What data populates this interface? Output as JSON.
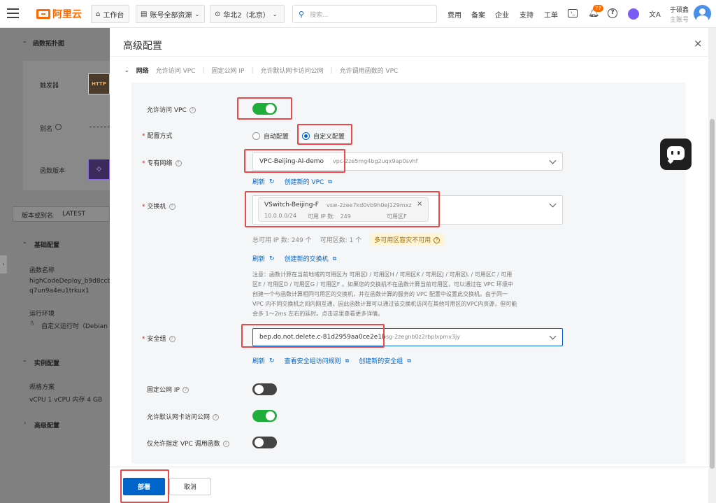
{
  "topbar": {
    "logo": "阿里云",
    "workbench": "工作台",
    "account_scope": "账号全部资源",
    "region": "华北2（北京）",
    "search_placeholder": "搜索...",
    "links": [
      "费用",
      "备案",
      "企业",
      "支持",
      "工单"
    ],
    "notification_count": "77",
    "user_name": "于硕鑫",
    "user_role": "主账号"
  },
  "background": {
    "topology_title": "函数拓扑图",
    "trigger_label": "触发器",
    "trigger_badge": "HTTP",
    "alias_label": "别名",
    "version_label": "函数版本",
    "version_alias": "版本或别名",
    "version_alias_value": "LATEST",
    "basic_title": "基础配置",
    "func_name_label": "函数名称",
    "func_name_line1": "highCodeDeploy_b9d8ccb2",
    "func_name_line2": "q7un9a4eu1trkux1",
    "runtime_label": "运行环境",
    "runtime_value": "自定义运行时（Debian",
    "instance_title": "实例配置",
    "spec_label": "规格方案",
    "spec_value": "vCPU  1 vCPU    内存  4 GB",
    "advanced_title": "高级配置"
  },
  "drawer": {
    "title": "高级配置",
    "close": "×",
    "tabs": [
      "网络",
      "允许访问 VPC",
      "固定公网 IP",
      "允许默认网卡访问公网",
      "允许调用函数的 VPC"
    ],
    "allow_vpc_label": "允许访问 VPC",
    "config_mode_label": "配置方式",
    "auto_config": "自动配置",
    "custom_config": "自定义配置",
    "vpc_label": "专有网络",
    "vpc_name": "VPC-Beijing-AI-demo",
    "vpc_id": "vpc-2ze5mg4bg2uqx9ap0svhf",
    "refresh": "刷新",
    "create_vpc": "创建新的 VPC",
    "vswitch_label": "交换机",
    "vswitch_name": "VSwitch-Beijing-F",
    "vswitch_id": "vsw-2zee7kd0vb9h0ej129mxz",
    "vswitch_cidr": "10.0.0.0/24",
    "vswitch_ips": "可用 IP 数:   249",
    "vswitch_zone": "可用区F",
    "total_ips": "总可用 IP 数: 249 个",
    "zone_count": "可用区数: 1 个",
    "multi_zone": "多可用区容灾不可用",
    "create_vswitch": "创建新的交换机",
    "note_lines": [
      "注意：函数计算在当前地域的可用区为 可用区I / 可用区H / 可用区K / 可用区J / 可用区L / 可用区C / 可用",
      "区E / 可用区D / 可用区G / 可用区F 。如果您的交换机不在函数计算当前可用区，可以通过在 VPC 环境中",
      "创建一个与函数计算相同可用区的交换机，并在函数计算的服务的 VPC 配置中设置此交换机。由于同一",
      "VPC 内不同交换机之间内网互通，因此函数计算可以通过该交换机访问在其他可用区的VPC内资源，但可能",
      "会多 1～2ms 左右的延时。点击这里查看更多详情。"
    ],
    "sg_label": "安全组",
    "sg_name": "bep.do.not.delete.c-81d2959aa0ce2e1b",
    "sg_id": "sg-2zegnb0z2rbplxpmv3jy",
    "view_sg_rules": "查看安全组访问规则",
    "create_sg": "创建新的安全组",
    "fixed_ip_label": "固定公网 IP",
    "default_nic_label": "允许默认网卡访问公网",
    "only_vpc_label": "仅允许指定 VPC 调用函数",
    "deploy": "部署",
    "cancel": "取消"
  },
  "colors": {
    "brand": "#ff6a00",
    "primary": "#0064c8",
    "toggle_on": "#1fad3c",
    "highlight_box": "#e84a4a"
  }
}
